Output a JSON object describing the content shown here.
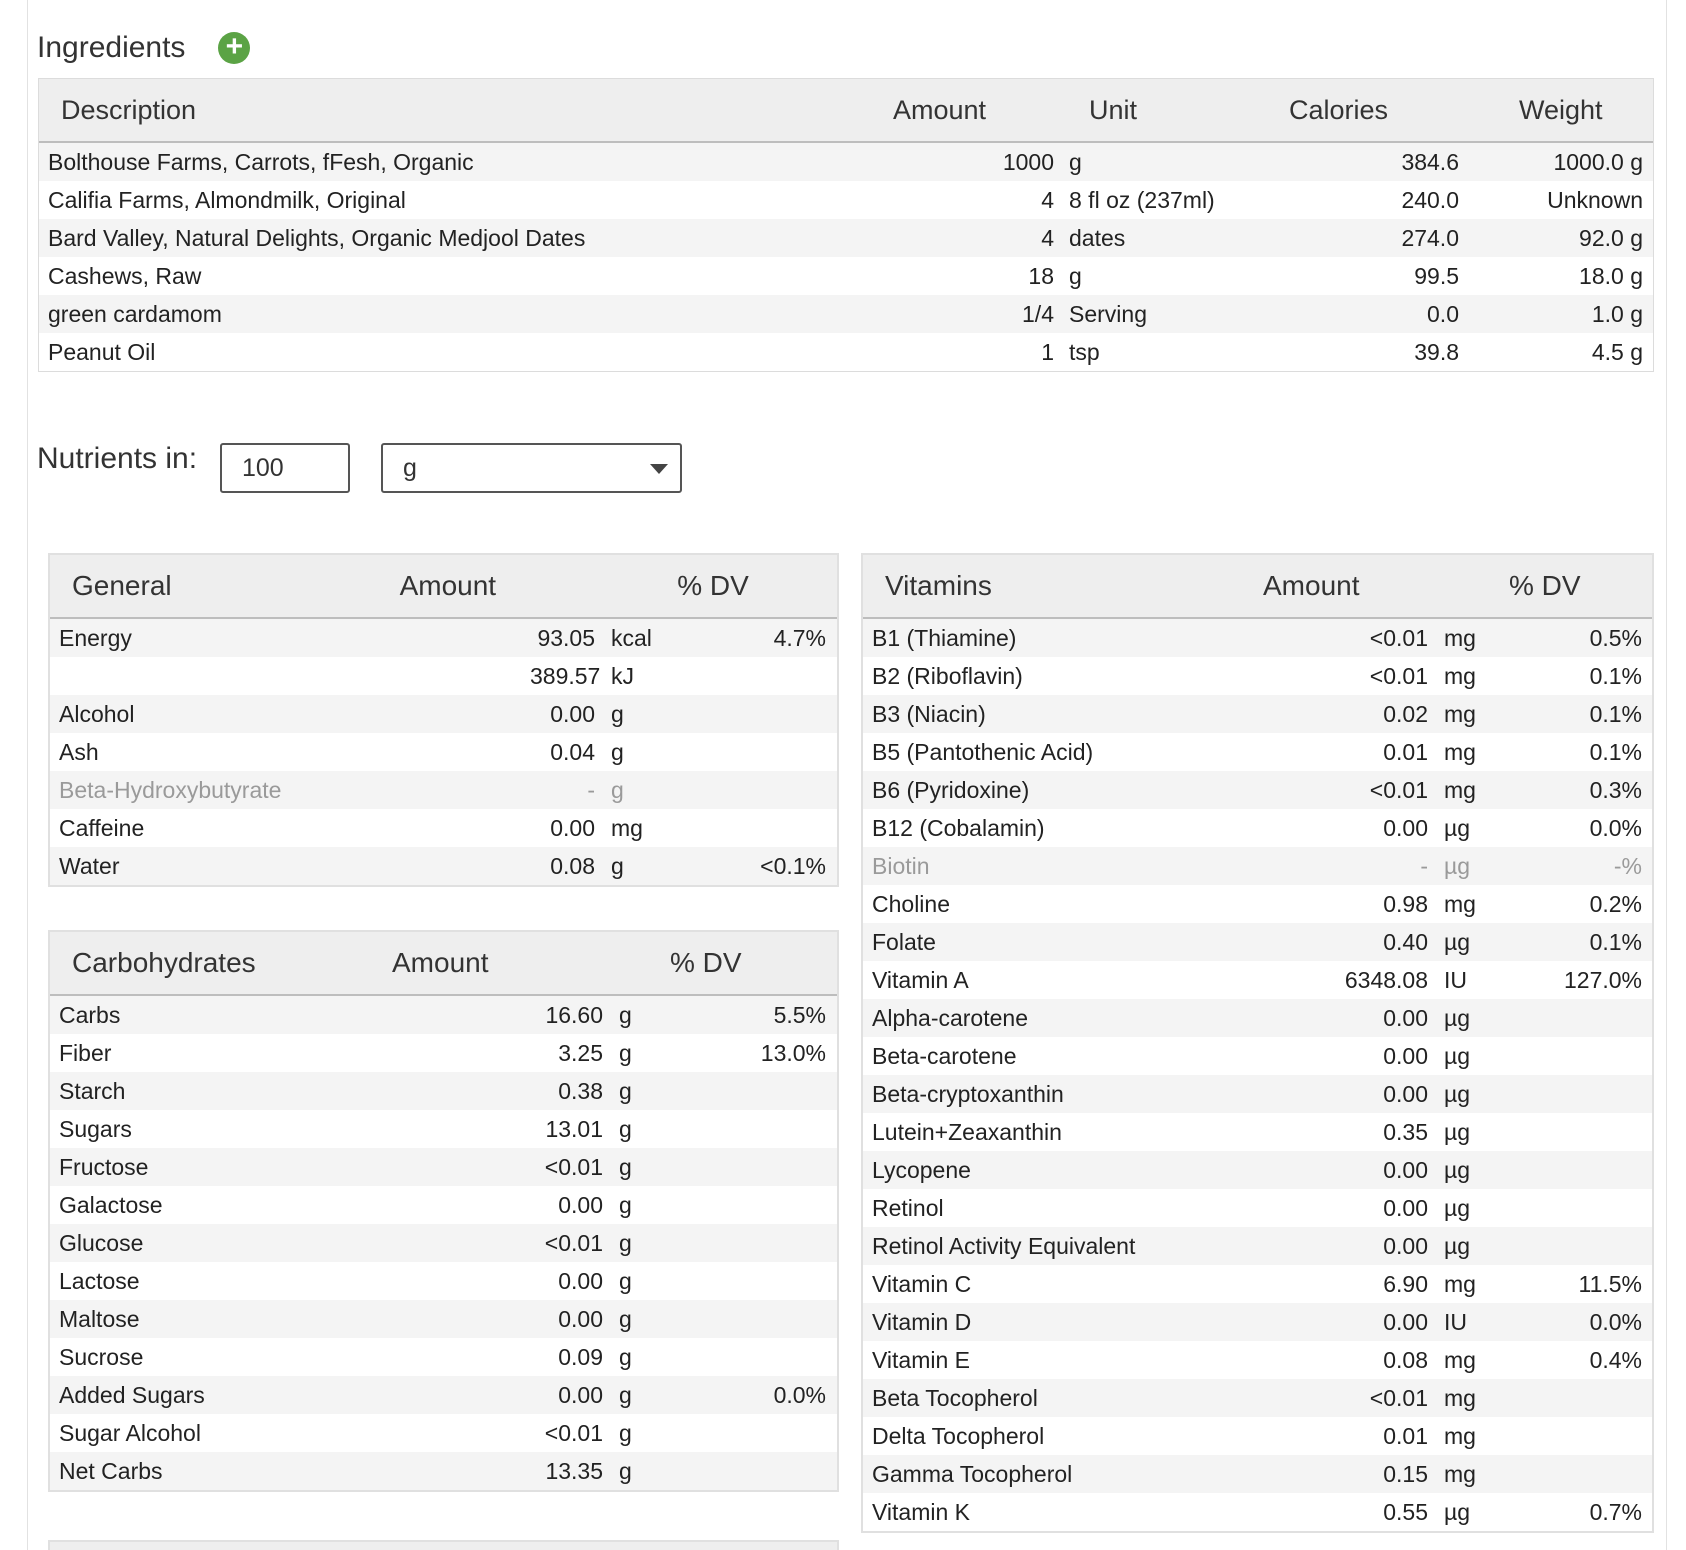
{
  "ingredients": {
    "title": "Ingredients",
    "add_label": "+",
    "headers": {
      "description": "Description",
      "amount": "Amount",
      "unit": "Unit",
      "calories": "Calories",
      "weight": "Weight"
    },
    "rows": [
      {
        "description": "Bolthouse Farms, Carrots, fFesh, Organic",
        "amount": "1000",
        "unit": "g",
        "calories": "384.6",
        "weight": "1000.0 g"
      },
      {
        "description": "Califia Farms, Almondmilk, Original",
        "amount": "4",
        "unit": "8 fl oz (237ml)",
        "calories": "240.0",
        "weight": "Unknown"
      },
      {
        "description": "Bard Valley, Natural Delights, Organic Medjool Dates",
        "amount": "4",
        "unit": "dates",
        "calories": "274.0",
        "weight": "92.0 g"
      },
      {
        "description": "Cashews, Raw",
        "amount": "18",
        "unit": "g",
        "calories": "99.5",
        "weight": "18.0 g"
      },
      {
        "description": "green cardamom",
        "amount": "1/4",
        "unit": "Serving",
        "calories": "0.0",
        "weight": "1.0 g"
      },
      {
        "description": "Peanut Oil",
        "amount": "1",
        "unit": "tsp",
        "calories": "39.8",
        "weight": "4.5 g"
      }
    ]
  },
  "nutrients_in": {
    "label": "Nutrients in:",
    "amount_value": "100",
    "unit_selected": "g"
  },
  "general": {
    "headers": {
      "name": "General",
      "amount": "Amount",
      "dv": "% DV"
    },
    "rows": [
      {
        "name": "Energy",
        "amount": "93.05",
        "unit": "kcal",
        "dv": "4.7%"
      },
      {
        "name": "",
        "amount": "389.57",
        "unit": "kJ",
        "dv": ""
      },
      {
        "name": "Alcohol",
        "amount": "0.00",
        "unit": "g",
        "dv": ""
      },
      {
        "name": "Ash",
        "amount": "0.04",
        "unit": "g",
        "dv": ""
      },
      {
        "name": "Beta-Hydroxybutyrate",
        "amount": "-",
        "unit": "g",
        "dv": "",
        "muted": true
      },
      {
        "name": "Caffeine",
        "amount": "0.00",
        "unit": "mg",
        "dv": ""
      },
      {
        "name": "Water",
        "amount": "0.08",
        "unit": "g",
        "dv": "<0.1%"
      }
    ]
  },
  "carbohydrates": {
    "headers": {
      "name": "Carbohydrates",
      "amount": "Amount",
      "dv": "% DV"
    },
    "rows": [
      {
        "name": "Carbs",
        "amount": "16.60",
        "unit": "g",
        "dv": "5.5%",
        "indent": 0
      },
      {
        "name": "Fiber",
        "amount": "3.25",
        "unit": "g",
        "dv": "13.0%",
        "indent": 1
      },
      {
        "name": "Starch",
        "amount": "0.38",
        "unit": "g",
        "dv": "",
        "indent": 1
      },
      {
        "name": "Sugars",
        "amount": "13.01",
        "unit": "g",
        "dv": "",
        "indent": 1
      },
      {
        "name": "Fructose",
        "amount": "<0.01",
        "unit": "g",
        "dv": "",
        "indent": 2
      },
      {
        "name": "Galactose",
        "amount": "0.00",
        "unit": "g",
        "dv": "",
        "indent": 2
      },
      {
        "name": "Glucose",
        "amount": "<0.01",
        "unit": "g",
        "dv": "",
        "indent": 2
      },
      {
        "name": "Lactose",
        "amount": "0.00",
        "unit": "g",
        "dv": "",
        "indent": 2
      },
      {
        "name": "Maltose",
        "amount": "0.00",
        "unit": "g",
        "dv": "",
        "indent": 2
      },
      {
        "name": "Sucrose",
        "amount": "0.09",
        "unit": "g",
        "dv": "",
        "indent": 2
      },
      {
        "name": "Added Sugars",
        "amount": "0.00",
        "unit": "g",
        "dv": "0.0%",
        "indent": 1
      },
      {
        "name": "Sugar Alcohol",
        "amount": "<0.01",
        "unit": "g",
        "dv": "",
        "indent": 1
      },
      {
        "name": "Net Carbs",
        "amount": "13.35",
        "unit": "g",
        "dv": "",
        "indent": 1
      }
    ]
  },
  "vitamins": {
    "headers": {
      "name": "Vitamins",
      "amount": "Amount",
      "dv": "% DV"
    },
    "rows": [
      {
        "name": "B1 (Thiamine)",
        "amount": "<0.01",
        "unit": "mg",
        "dv": "0.5%",
        "indent": 0
      },
      {
        "name": "B2 (Riboflavin)",
        "amount": "<0.01",
        "unit": "mg",
        "dv": "0.1%",
        "indent": 0
      },
      {
        "name": "B3 (Niacin)",
        "amount": "0.02",
        "unit": "mg",
        "dv": "0.1%",
        "indent": 0
      },
      {
        "name": "B5 (Pantothenic Acid)",
        "amount": "0.01",
        "unit": "mg",
        "dv": "0.1%",
        "indent": 0
      },
      {
        "name": "B6 (Pyridoxine)",
        "amount": "<0.01",
        "unit": "mg",
        "dv": "0.3%",
        "indent": 0
      },
      {
        "name": "B12 (Cobalamin)",
        "amount": "0.00",
        "unit": "µg",
        "dv": "0.0%",
        "indent": 0
      },
      {
        "name": "Biotin",
        "amount": "-",
        "unit": "µg",
        "dv": "-%",
        "indent": 0,
        "muted": true
      },
      {
        "name": "Choline",
        "amount": "0.98",
        "unit": "mg",
        "dv": "0.2%",
        "indent": 0
      },
      {
        "name": "Folate",
        "amount": "0.40",
        "unit": "µg",
        "dv": "0.1%",
        "indent": 0
      },
      {
        "name": "Vitamin A",
        "amount": "6348.08",
        "unit": "IU",
        "dv": "127.0%",
        "indent": 0
      },
      {
        "name": "Alpha-carotene",
        "amount": "0.00",
        "unit": "µg",
        "dv": "",
        "indent": 1
      },
      {
        "name": "Beta-carotene",
        "amount": "0.00",
        "unit": "µg",
        "dv": "",
        "indent": 1
      },
      {
        "name": "Beta-cryptoxanthin",
        "amount": "0.00",
        "unit": "µg",
        "dv": "",
        "indent": 1
      },
      {
        "name": "Lutein+Zeaxanthin",
        "amount": "0.35",
        "unit": "µg",
        "dv": "",
        "indent": 1
      },
      {
        "name": "Lycopene",
        "amount": "0.00",
        "unit": "µg",
        "dv": "",
        "indent": 1
      },
      {
        "name": "Retinol",
        "amount": "0.00",
        "unit": "µg",
        "dv": "",
        "indent": 1
      },
      {
        "name": "Retinol Activity Equivalent",
        "amount": "0.00",
        "unit": "µg",
        "dv": "",
        "indent": 1
      },
      {
        "name": "Vitamin C",
        "amount": "6.90",
        "unit": "mg",
        "dv": "11.5%",
        "indent": 0
      },
      {
        "name": "Vitamin D",
        "amount": "0.00",
        "unit": "IU",
        "dv": "0.0%",
        "indent": 0
      },
      {
        "name": "Vitamin E",
        "amount": "0.08",
        "unit": "mg",
        "dv": "0.4%",
        "indent": 0
      },
      {
        "name": "Beta Tocopherol",
        "amount": "<0.01",
        "unit": "mg",
        "dv": "",
        "indent": 1
      },
      {
        "name": "Delta Tocopherol",
        "amount": "0.01",
        "unit": "mg",
        "dv": "",
        "indent": 1
      },
      {
        "name": "Gamma Tocopherol",
        "amount": "0.15",
        "unit": "mg",
        "dv": "",
        "indent": 1
      },
      {
        "name": "Vitamin K",
        "amount": "0.55",
        "unit": "µg",
        "dv": "0.7%",
        "indent": 0
      }
    ]
  },
  "colors": {
    "accent_green": "#5ba345",
    "header_bg": "#eeeeee",
    "muted_text": "#9a9a9a"
  }
}
